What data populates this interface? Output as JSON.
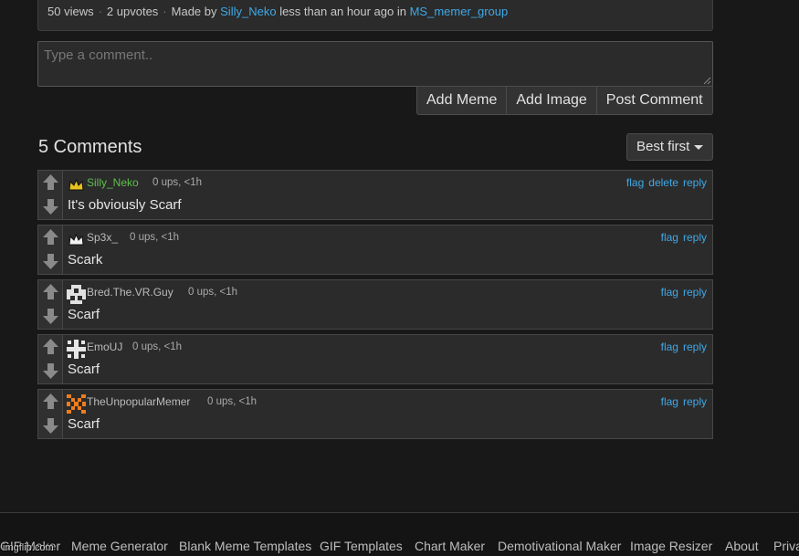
{
  "post_info": {
    "views": "50 views",
    "upvotes": "2 upvotes",
    "made_by_label": "Made by",
    "author": "Silly_Neko",
    "time_text": "less than an hour ago in",
    "stream": "MS_memer_group"
  },
  "comment_form": {
    "placeholder": "Type a comment..",
    "add_meme": "Add Meme",
    "add_image": "Add Image",
    "post_comment": "Post Comment"
  },
  "comments_header": {
    "count_text": "5 Comments",
    "sort_label": "Best first"
  },
  "comments": [
    {
      "username": "Silly_Neko",
      "meta": "0 ups, <1h",
      "text": "It's obviously Scarf",
      "actions": [
        "flag",
        "delete",
        "reply"
      ],
      "avatar": "crown-icon",
      "user_color": "#5dc14a"
    },
    {
      "username": "Sp3x_",
      "meta": "0 ups, <1h",
      "text": "Scark",
      "actions": [
        "flag",
        "reply"
      ],
      "avatar": "crown-icon"
    },
    {
      "username": "Bred.The.VR.Guy",
      "meta": "0 ups, <1h",
      "text": "Scarf",
      "actions": [
        "flag",
        "reply"
      ],
      "avatar": "pixel-avatar-icon"
    },
    {
      "username": "EmoUJ",
      "meta": "0 ups, <1h",
      "text": "Scarf",
      "actions": [
        "flag",
        "reply"
      ],
      "avatar": "pixel-avatar-icon"
    },
    {
      "username": "TheUnpopularMemer",
      "meta": "0 ups, <1h",
      "text": "Scarf",
      "actions": [
        "flag",
        "reply"
      ],
      "avatar": "pixel-avatar-icon"
    }
  ],
  "footer": {
    "links": [
      "GIF Maker",
      "Meme Generator",
      "Blank Meme Templates",
      "GIF Templates",
      "Chart Maker",
      "Demotivational Maker",
      "Image Resizer",
      "About",
      "Priva"
    ],
    "watermark": "imgflip.com"
  },
  "colors": {
    "link": "#3fa9e8",
    "op_username": "#5dc14a",
    "background": "#181818",
    "panel": "#2b2b2b"
  }
}
